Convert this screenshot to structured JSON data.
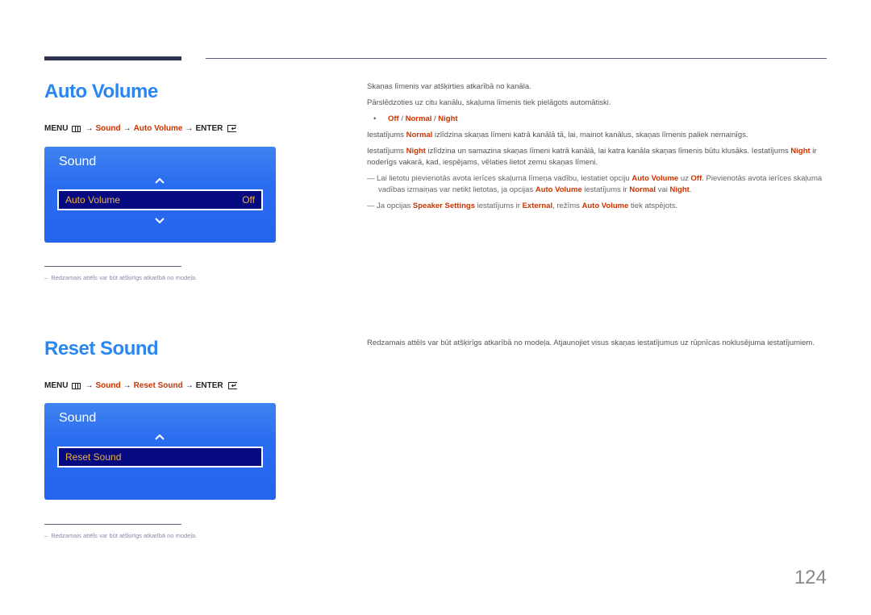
{
  "sections": [
    {
      "title": "Auto Volume",
      "menu_path": {
        "menu": "MENU",
        "sound": "Sound",
        "item": "Auto Volume",
        "enter": "ENTER",
        "arrow": "→"
      },
      "osd": {
        "title": "Sound",
        "item_label": "Auto Volume",
        "item_value": "Off",
        "icons": [
          "chevron-up-icon",
          "chevron-down-icon"
        ]
      },
      "footnote": "Redzamais attēls var būt atšķirīgs atkarībā no modeļa.",
      "body": {
        "p1": "Skaņas līmenis var atšķirties atkarībā no kanāla.",
        "p2": "Pārslēdzoties uz citu kanālu, skaļuma līmenis tiek pielāgots automātiski.",
        "options": {
          "bullet": "•",
          "off": "Off",
          "sep": " / ",
          "normal": "Normal",
          "night": "Night"
        },
        "normal_desc": {
          "pre": "Iestatījums ",
          "key": "Normal",
          "post": " izlīdzina skaņas līmeni katrā kanālā tā, lai, mainot kanālus, skaņas līmenis paliek nemainīgs."
        },
        "night_desc": {
          "pre": "Iestatījums ",
          "key": "Night",
          "mid": " izlīdzina un samazina skaņas līmeni katrā kanālā, lai katra kanāla skaņas līmenis būtu klusāks. Iestatījums ",
          "key2": "Night",
          "post": " ir noderīgs vakarā, kad, iespējams, vēlaties lietot zemu skaņas līmeni."
        },
        "note1": {
          "dash": "—",
          "a": "Lai lietotu pievienotās avota ierīces skaļuma līmeņa vadību, iestatiet opciju ",
          "k1": "Auto Volume",
          "b": " uz ",
          "k2": "Off",
          "c": ". Pievienotās avota ierīces skaļuma vadības izmaiņas var netikt lietotas, ja opcijas ",
          "k3": "Auto Volume",
          "d": " iestatījums ir ",
          "k4": "Normal",
          "e": " vai ",
          "k5": "Night",
          "f": "."
        },
        "note2": {
          "dash": "—",
          "a": "Ja opcijas ",
          "k1": "Speaker Settings",
          "b": " iestatījums ir ",
          "k2": "External",
          "c": ", režīms ",
          "k3": "Auto Volume",
          "d": " tiek atspējots."
        }
      }
    },
    {
      "title": "Reset Sound",
      "menu_path": {
        "menu": "MENU",
        "sound": "Sound",
        "item": "Reset Sound",
        "enter": "ENTER",
        "arrow": "→"
      },
      "osd": {
        "title": "Sound",
        "item_label": "Reset Sound",
        "icons": [
          "chevron-up-icon"
        ]
      },
      "footnote": "Redzamais attēls var būt atšķirīgs atkarībā no modeļa.",
      "body": {
        "p1": "Redzamais attēls var būt atšķirīgs atkarībā no modeļa. Atjaunojiet visus skaņas iestatījumus uz rūpnīcas noklusējuma iestatījumiem."
      }
    }
  ],
  "colors": {
    "title_blue": "#2a86f0",
    "highlight_red": "#cc3300",
    "osd_blue": "#2a6cf0",
    "osd_item_bg": "#050a80",
    "osd_item_text": "#f0b040"
  },
  "page_number": "124"
}
